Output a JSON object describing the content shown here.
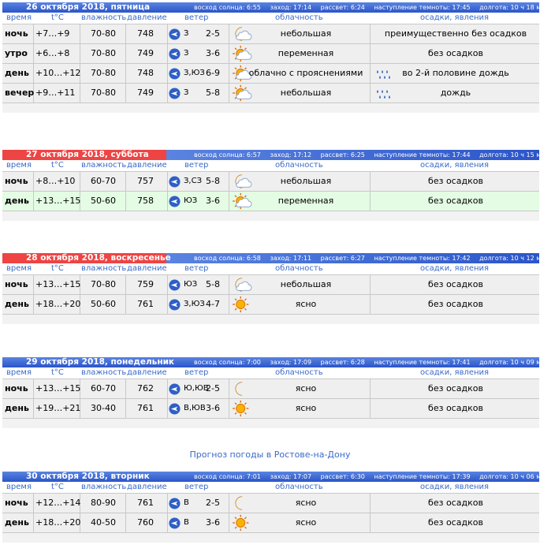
{
  "columns": {
    "time": "время",
    "temp": "t°C",
    "hum": "влажность",
    "pres": "давление",
    "wind": "ветер",
    "cloud": "облачность",
    "precip": "осадки, явления"
  },
  "link_text": "Прогноз погоды в Ростове-на-Дону",
  "days": [
    {
      "date": "26 октября 2018, пятница",
      "sunrise": "восход солнца: 6:55",
      "sunset": "заход: 17:14",
      "dawn": "рассвет: 6:24",
      "dark": "наступление темноты: 17:45",
      "length": "долгота: 10 ч 18 м",
      "rows": [
        {
          "period": "ночь",
          "temp": "+7…+9",
          "hum": "70-80",
          "pres": "748",
          "dir": "З",
          "spd": "2-5",
          "cloud": "небольшая",
          "precip": "преимущественно без осадков",
          "icon": "moon-cloud",
          "rain": false
        },
        {
          "period": "утро",
          "temp": "+6…+8",
          "hum": "70-80",
          "pres": "749",
          "dir": "З",
          "spd": "3-6",
          "cloud": "переменная",
          "precip": "без осадков",
          "icon": "sun-cloud",
          "rain": false
        },
        {
          "period": "день",
          "temp": "+10…+12",
          "hum": "70-80",
          "pres": "748",
          "dir": "З,ЮЗ",
          "spd": "6-9",
          "cloud": "облачно с прояснениями",
          "precip": "во 2-й половине дождь",
          "icon": "sun-cloud",
          "rain": true
        },
        {
          "period": "вечер",
          "temp": "+9…+11",
          "hum": "70-80",
          "pres": "749",
          "dir": "З",
          "spd": "5-8",
          "cloud": "небольшая",
          "precip": "дождь",
          "icon": "sun-cloud",
          "rain": true
        }
      ]
    },
    {
      "date": "27 октября 2018, суббота",
      "sunrise": "восход солнца: 6:57",
      "sunset": "заход: 17:12",
      "dawn": "рассвет: 6:25",
      "dark": "наступление темноты: 17:44",
      "length": "долгота: 10 ч 15 м",
      "rows": [
        {
          "period": "ночь",
          "temp": "+8…+10",
          "hum": "60-70",
          "pres": "757",
          "dir": "З,СЗ",
          "spd": "5-8",
          "cloud": "небольшая",
          "precip": "без осадков",
          "icon": "moon-cloud",
          "rain": false
        },
        {
          "period": "день",
          "temp": "+13…+15",
          "hum": "50-60",
          "pres": "758",
          "dir": "ЮЗ",
          "spd": "3-6",
          "cloud": "переменная",
          "precip": "без осадков",
          "icon": "sun-cloud",
          "rain": false
        }
      ]
    },
    {
      "date": "28 октября 2018, воскресенье",
      "sunrise": "восход солнца: 6:58",
      "sunset": "заход: 17:11",
      "dawn": "рассвет: 6:27",
      "dark": "наступление темноты: 17:42",
      "length": "долгота: 10 ч 12 м",
      "rows": [
        {
          "period": "ночь",
          "temp": "+13…+15",
          "hum": "70-80",
          "pres": "759",
          "dir": "ЮЗ",
          "spd": "5-8",
          "cloud": "небольшая",
          "precip": "без осадков",
          "icon": "moon-cloud",
          "rain": false
        },
        {
          "period": "день",
          "temp": "+18…+20",
          "hum": "50-60",
          "pres": "761",
          "dir": "З,ЮЗ",
          "spd": "4-7",
          "cloud": "ясно",
          "precip": "без осадков",
          "icon": "sun",
          "rain": false
        }
      ]
    },
    {
      "date": "29 октября 2018, понедельник",
      "sunrise": "восход солнца: 7:00",
      "sunset": "заход: 17:09",
      "dawn": "рассвет: 6:28",
      "dark": "наступление темноты: 17:41",
      "length": "долгота: 10 ч 09 м",
      "rows": [
        {
          "period": "ночь",
          "temp": "+13…+15",
          "hum": "60-70",
          "pres": "762",
          "dir": "Ю,ЮВ",
          "spd": "2-5",
          "cloud": "ясно",
          "precip": "без осадков",
          "icon": "moon",
          "rain": false
        },
        {
          "period": "день",
          "temp": "+19…+21",
          "hum": "30-40",
          "pres": "761",
          "dir": "В,ЮВ",
          "spd": "3-6",
          "cloud": "ясно",
          "precip": "без осадков",
          "icon": "sun",
          "rain": false
        }
      ]
    },
    {
      "date": "30 октября 2018, вторник",
      "sunrise": "восход солнца: 7:01",
      "sunset": "заход: 17:07",
      "dawn": "рассвет: 6:30",
      "dark": "наступление темноты: 17:39",
      "length": "долгота: 10 ч 06 м",
      "rows": [
        {
          "period": "ночь",
          "temp": "+12…+14",
          "hum": "80-90",
          "pres": "761",
          "dir": "В",
          "spd": "2-5",
          "cloud": "ясно",
          "precip": "без осадков",
          "icon": "moon",
          "rain": false
        },
        {
          "period": "день",
          "temp": "+18…+20",
          "hum": "40-50",
          "pres": "760",
          "dir": "В",
          "spd": "3-6",
          "cloud": "ясно",
          "precip": "без осадков",
          "icon": "sun",
          "rain": false
        }
      ]
    }
  ]
}
